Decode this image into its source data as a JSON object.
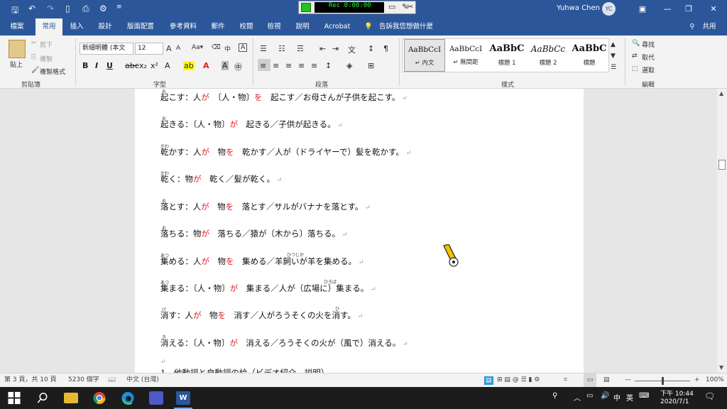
{
  "titlebar": {
    "save_icon": "save-icon",
    "undo_icon": "undo-icon",
    "redo_icon": "redo-icon",
    "new_icon": "new-doc-icon",
    "preview_icon": "print-preview-icon",
    "custom_icon": "customize-icon",
    "user": "Yuhwa Chen",
    "avatar": "YC",
    "min": "—",
    "max": "❐",
    "close": "✕"
  },
  "recorder": {
    "time": "Rec 0:00:00"
  },
  "tabs": [
    "檔案",
    "常用",
    "插入",
    "設計",
    "版面配置",
    "參考資料",
    "郵件",
    "校閱",
    "檢視",
    "說明",
    "Acrobat",
    "告訴我您想做什麼"
  ],
  "share": "共用",
  "ribbon": {
    "clipboard": {
      "paste": "貼上",
      "cut": "剪下",
      "copy": "複製",
      "format_painter": "複製格式",
      "label": "剪貼簿"
    },
    "font": {
      "name": "新細明體 (本文",
      "size": "12",
      "label": "字型",
      "aa": "Aa▾"
    },
    "paragraph": {
      "label": "段落"
    },
    "styles": {
      "items": [
        {
          "sample": "AaBbCcI",
          "name": "↵ 內文"
        },
        {
          "sample": "AaBbCcI",
          "name": "↵ 無間距"
        },
        {
          "sample": "AaBbC",
          "name": "標題 1"
        },
        {
          "sample": "AaBbCc",
          "name": "標題 2"
        },
        {
          "sample": "AaBbC",
          "name": "標題"
        }
      ],
      "label": "樣式"
    },
    "editing": {
      "find": "尋找",
      "replace": "取代",
      "select": "選取",
      "label": "編輯"
    }
  },
  "document": {
    "lines": [
      {
        "a": "起こす：人",
        "b": "が",
        "c": "　〔人・物〕",
        "d": "を",
        "e": "　起こす／お母さんが子供を起こす。"
      },
      {
        "a": "起きる：〔人・物〕",
        "b": "が",
        "c": "　起きる／子供が起きる。",
        "d": "",
        "e": ""
      },
      {
        "a": "乾かす：人",
        "b": "が",
        "c": "　物",
        "d": "を",
        "e": "　乾かす／人が（ドライヤーで）髪を乾かす。"
      },
      {
        "a": "乾く：物",
        "b": "が",
        "c": "　乾く／髪が乾く。",
        "d": "",
        "e": ""
      },
      {
        "a": "落とす：人",
        "b": "が",
        "c": "　物",
        "d": "を",
        "e": "　落とす／サルがバナナを落とす。"
      },
      {
        "a": "落ちる：物",
        "b": "が",
        "c": "　落ちる／猿が〔木から〕落ちる。",
        "d": "",
        "e": ""
      },
      {
        "a": "集める：人",
        "b": "が",
        "c": "　物",
        "d": "を",
        "e": "　集める／羊飼いが羊を集める。"
      },
      {
        "a": "集まる：〔人・物〕",
        "b": "が",
        "c": "　集まる／人が（広場に）集まる。",
        "d": "",
        "e": ""
      },
      {
        "a": "消す：人",
        "b": "が",
        "c": "　物",
        "d": "を",
        "e": "　消す／人がろうそくの火を消す。"
      },
      {
        "a": "消える：〔人・物〕",
        "b": "が",
        "c": "　消える／ろうそくの火が（風で）消える。",
        "d": "",
        "e": ""
      }
    ],
    "last_line": "1．他動詞と自動詞の絵（ビデオ紹介，説明）",
    "ruby": [
      "お",
      "お",
      "かわ",
      "かわ",
      "お",
      "お",
      "あつ",
      "ひつじか",
      "あつ",
      "ひろば",
      "け",
      "ひ",
      "き"
    ]
  },
  "status": {
    "page": "第 3 頁，共 10 頁",
    "words": "5230 個字",
    "lang": "中文 (台灣)",
    "zoom": "100%"
  },
  "taskbar": {
    "time": "下午 10:44",
    "date": "2020/7/1",
    "ime": "英"
  }
}
